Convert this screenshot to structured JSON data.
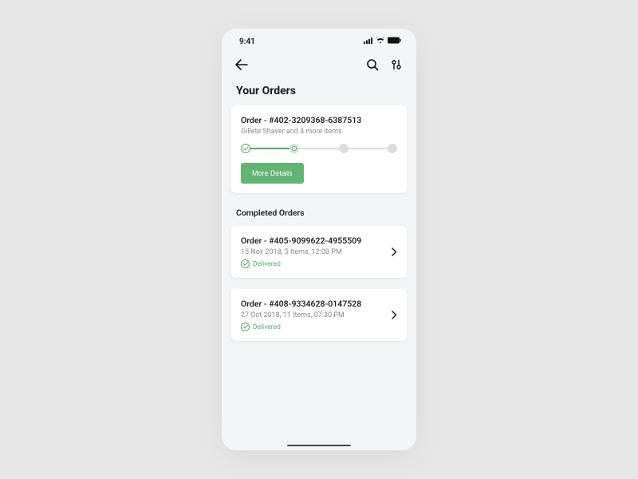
{
  "status": {
    "time": "9:41"
  },
  "page": {
    "title": "Your Orders"
  },
  "activeOrder": {
    "title": "Order - #402-3209368-6387513",
    "subtitle": "Gillete Shaver and 4 more items",
    "button": "More Details"
  },
  "completedSection": {
    "title": "Completed Orders"
  },
  "completed": [
    {
      "title": "Order - #405-9099622-4955509",
      "subtitle": "15 Nov 2018, 5 Items, 12:00 PM",
      "status": "Delivered"
    },
    {
      "title": "Order - #408-9334628-0147528",
      "subtitle": "27 Oct 2018, 11 Items, 07:30 PM",
      "status": "Delivered"
    }
  ]
}
